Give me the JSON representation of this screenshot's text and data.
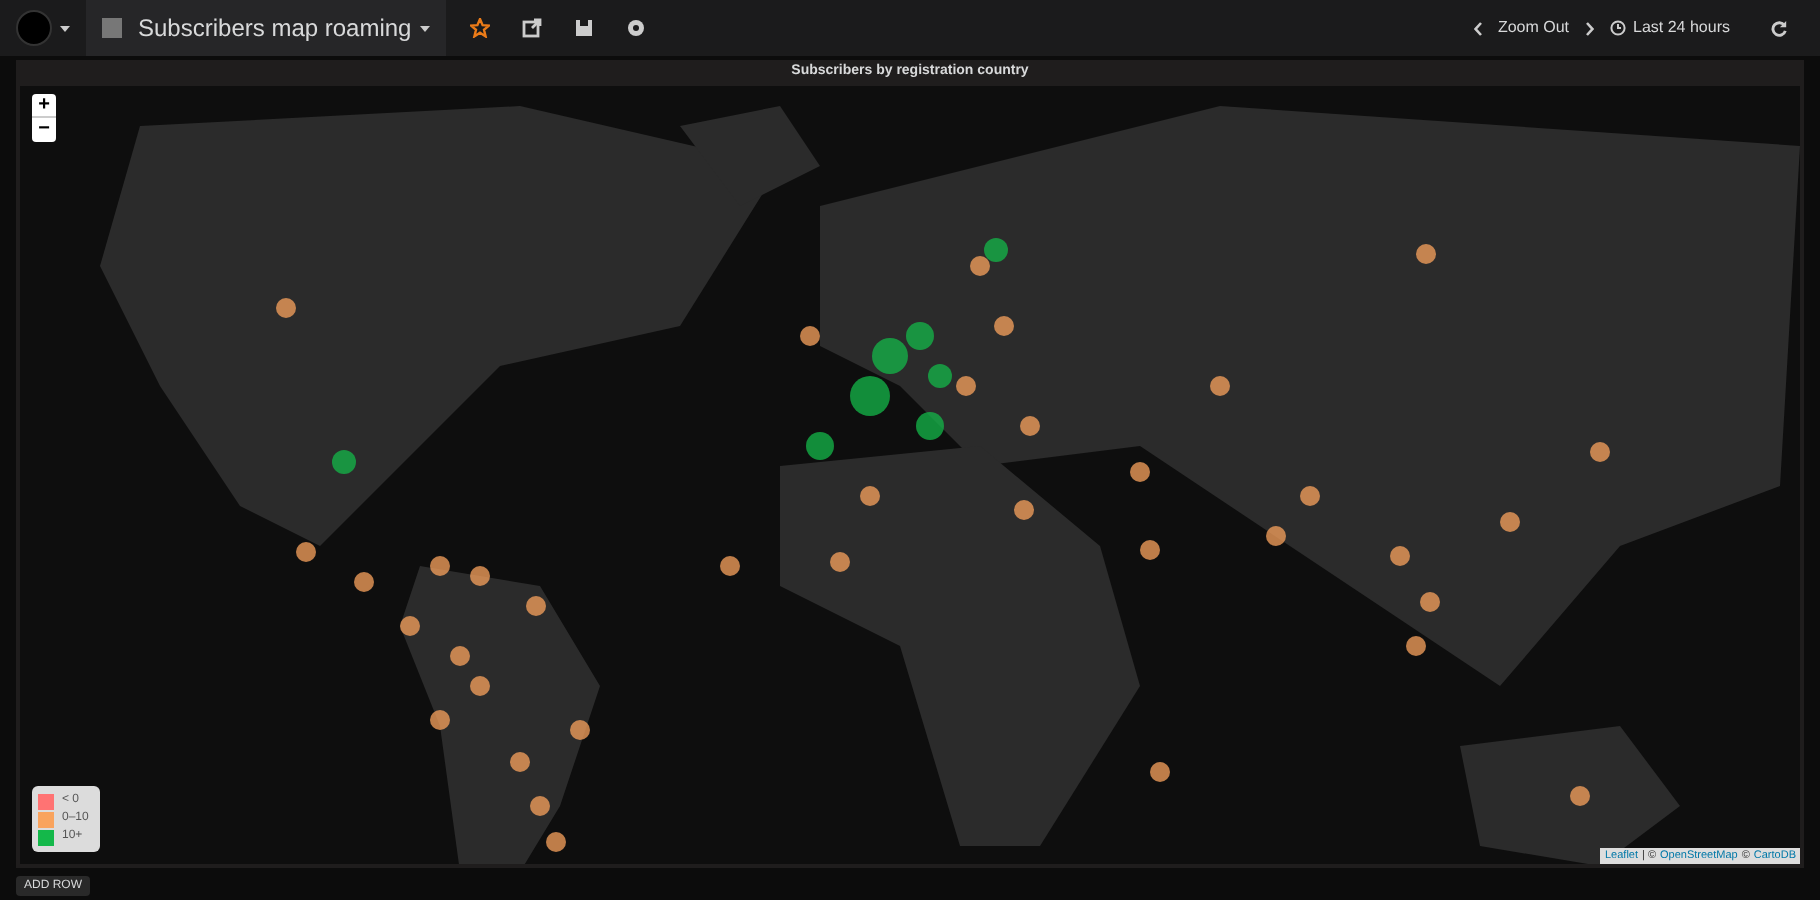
{
  "navbar": {
    "dashboard_title": "Subscribers map roaming",
    "zoom_out": "Zoom Out",
    "time_range": "Last 24 hours"
  },
  "panel": {
    "title": "Subscribers by registration country",
    "zoom_in": "+",
    "zoom_out": "−",
    "legend": [
      {
        "label": "< 0",
        "color": "#ff7373"
      },
      {
        "label": "0–10",
        "color": "#f9a35d"
      },
      {
        "label": "10+",
        "color": "#14b84a"
      }
    ],
    "attribution": {
      "link_1": "Leaflet",
      "separator": "| ©",
      "link_2": "OpenStreetMap",
      "separator_2": "©",
      "link_3": "CartoDB"
    }
  },
  "add_row": "ADD ROW"
}
